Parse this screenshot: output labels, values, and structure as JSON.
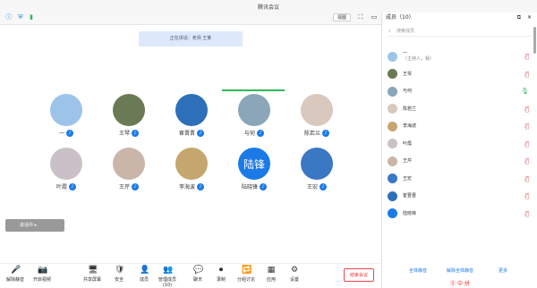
{
  "window": {
    "title": "腾讯会议"
  },
  "notice": {
    "text": "正在讲话：老师 王某"
  },
  "view_button": {
    "label": "视图"
  },
  "participants_grid": [
    {
      "name": "一",
      "color": "#9bc4e8",
      "initial": ""
    },
    {
      "name": "王琴",
      "color": "#6a7a54",
      "initial": ""
    },
    {
      "name": "崔晋晋",
      "color": "#2d6fb9",
      "initial": ""
    },
    {
      "name": "与何",
      "color": "#8aa6b8",
      "initial": ""
    },
    {
      "name": "陈若兰",
      "color": "#d9c8bd",
      "initial": ""
    },
    {
      "name": "叶霞",
      "color": "#c9c1c7",
      "initial": ""
    },
    {
      "name": "王芹",
      "color": "#c9b6a8",
      "initial": ""
    },
    {
      "name": "李海波",
      "color": "#c5a66e",
      "initial": ""
    },
    {
      "name": "陆晓锋",
      "color": "#1b7ae8",
      "initial": "陆锋"
    },
    {
      "name": "王宏",
      "color": "#3a78c4",
      "initial": ""
    }
  ],
  "side_pill": {
    "label": "讲话中 ▸"
  },
  "toolbar": {
    "items": [
      {
        "label": "解除静音",
        "icon": "🎤"
      },
      {
        "label": "开启视频",
        "icon": "📷"
      },
      {
        "label": "共享屏幕",
        "icon": "🖥"
      },
      {
        "label": "安全",
        "icon": "🛡"
      },
      {
        "label": "成员",
        "icon": "👤"
      },
      {
        "label": "管理成员(10)",
        "icon": "👥"
      },
      {
        "label": "聊天",
        "icon": "💬"
      },
      {
        "label": "录制",
        "icon": "⏺"
      },
      {
        "label": "分组讨论",
        "icon": "🔁"
      },
      {
        "label": "应用",
        "icon": "▦"
      },
      {
        "label": "设置",
        "icon": "⚙"
      }
    ],
    "end_label": "结束会议"
  },
  "panel": {
    "title": "成员（10）",
    "search_placeholder": "搜索成员",
    "members": [
      {
        "name": "一",
        "sub": "（主持人，我）",
        "color": "#9bc4e8",
        "mic": "muted"
      },
      {
        "name": "王琴",
        "sub": "",
        "color": "#6a7a54",
        "mic": "muted"
      },
      {
        "name": "与何",
        "sub": "",
        "color": "#8aa6b8",
        "mic": "on"
      },
      {
        "name": "陈若兰",
        "sub": "",
        "color": "#d9c8bd",
        "mic": "muted"
      },
      {
        "name": "李海波",
        "sub": "",
        "color": "#c5a66e",
        "mic": "muted"
      },
      {
        "name": "叶霞",
        "sub": "",
        "color": "#c9c1c7",
        "mic": "muted"
      },
      {
        "name": "王芹",
        "sub": "",
        "color": "#c9b6a8",
        "mic": "muted"
      },
      {
        "name": "王宏",
        "sub": "",
        "color": "#3a78c4",
        "mic": "muted"
      },
      {
        "name": "崔晋晋",
        "sub": "",
        "color": "#2d6fb9",
        "mic": "muted"
      },
      {
        "name": "陆晓锋",
        "sub": "",
        "color": "#1b7ae8",
        "mic": "muted"
      }
    ],
    "footer_left": "全体静音",
    "footer_mid": "解除全体静音",
    "footer_right": "更多"
  },
  "tray": {
    "label": "中 拼"
  }
}
